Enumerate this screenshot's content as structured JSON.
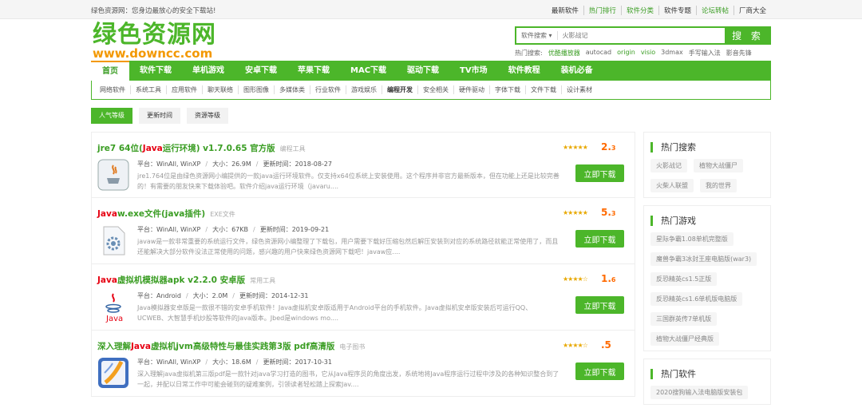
{
  "topbar": {
    "slogan": "绿色资源网：您身边最放心的安全下载站!",
    "links": [
      {
        "label": "最新软件",
        "green": false
      },
      {
        "label": "热门排行",
        "green": true
      },
      {
        "label": "软件分类",
        "green": true
      },
      {
        "label": "软件专题",
        "green": false
      },
      {
        "label": "论坛转帖",
        "green": true
      },
      {
        "label": "厂商大全",
        "green": false
      }
    ]
  },
  "logo": {
    "cn": "绿色资源网",
    "en": "www.downcc.com"
  },
  "search": {
    "scope": "软件搜索 ▾",
    "placeholder": "火影战记",
    "button": "搜 索",
    "hot_label": "热门搜索:",
    "hot": [
      {
        "label": "优酷播放器",
        "green": true
      },
      {
        "label": "autocad",
        "green": false
      },
      {
        "label": "origin",
        "green": true
      },
      {
        "label": "visio",
        "green": true
      },
      {
        "label": "3dmax",
        "green": false
      },
      {
        "label": "手写输入法",
        "green": false
      },
      {
        "label": "影音先锋",
        "green": false
      }
    ]
  },
  "nav": [
    "首页",
    "软件下载",
    "单机游戏",
    "安卓下载",
    "苹果下载",
    "MAC下载",
    "驱动下载",
    "TV市场",
    "软件教程",
    "装机必备"
  ],
  "subnav": [
    "网络软件",
    "系统工具",
    "应用软件",
    "聊天联络",
    "图形图像",
    "多媒体类",
    "行业软件",
    "游戏娱乐",
    "编程开发",
    "安全相关",
    "硬件驱动",
    "字体下载",
    "文件下载",
    "设计素材"
  ],
  "tabs": [
    "人气等级",
    "更新时间",
    "资源等级"
  ],
  "items": [
    {
      "pre": "jre7 64位(",
      "red": "Java",
      "post": "运行环境) v1.7.0.65 官方版",
      "cat": "编程工具",
      "platform": "平台：WinAll, WinXP",
      "size": "大小：26.9M",
      "date": "更新时间：2018-08-27",
      "desc": "jre1.764位是由绿色资源网小编提供的一款java运行环境软件。仅支持x64位系统上安装使用。这个程序并非官方最新版本，但在功能上还是比较完善的！有需要的朋友快来下载体验吧。软件介绍java运行环境（javaru....",
      "stars": 5,
      "score_main": "2.",
      "score_small": "3",
      "button": "立即下载",
      "icon": "java-cup-icon"
    },
    {
      "pre": "",
      "red": "Java",
      "post": "w.exe文件(java插件)",
      "cat": "EXE文件",
      "platform": "平台：WinAll, WinXP",
      "size": "大小：67KB",
      "date": "更新时间：2019-09-21",
      "desc": "javaw是一款非常重要的系统运行文件，绿色资源网小编整理了下载包，用户需要下载好压缩包然后解压安装到对应的系统路径就能正常使用了，而且还能解决大部分软件没法正常使用的问题，感兴趣的用户快来绿色资源网下载吧！javaw应....",
      "stars": 5,
      "score_main": "5.",
      "score_small": "3",
      "button": "立即下载",
      "icon": "exe-file-gear-icon"
    },
    {
      "pre": "",
      "red": "Java",
      "post": "虚拟机模拟器apk v2.2.0 安卓版",
      "cat": "常用工具",
      "platform": "平台：Android",
      "size": "大小：2.0M",
      "date": "更新时间：2014-12-31",
      "desc": "Java模拟器安卓版是一款很不错的安卓手机软件！Java虚拟机安卓版适用于Android平台的手机软件。Java虚拟机安卓版安装后可运行QQ、UCWEB、大智慧手机炒股等软件的Java版本。Jbed是windows mo....",
      "stars": 4,
      "score_main": "1.",
      "score_small": "6",
      "button": "立即下载",
      "icon": "java-logo-icon"
    },
    {
      "pre": "深入理解",
      "red": "Java",
      "post": "虚拟机jvm高级特性与最佳实践第3版 pdf高清版",
      "cat": "电子图书",
      "platform": "平台：WinAll, WinXP",
      "size": "大小：18.6M",
      "date": "更新时间：2017-10-31",
      "desc": "深入理解java虚拟机第三版pdf是一款针对java学习打造的图书，它从Java程序员的角度出发，系统地将Java程序运行过程中涉及的各种知识整合到了一起，并配以日常工作中可能会碰到的疑难案例，引领读者轻松踏上探索Jav....",
      "stars": 4,
      "score_main": ".5",
      "score_small": "",
      "button": "立即下载",
      "icon": "ebook-icon"
    }
  ],
  "sidebar": [
    {
      "title": "热门搜索",
      "tags": [
        "火影战记",
        "植物大战僵尸",
        "火柴人联盟",
        "我的世界"
      ]
    },
    {
      "title": "热门游戏",
      "tags": [
        "星际争霸1.08单机完整版",
        "魔兽争霸3冰封王座电脑版(war3)",
        "反恐精英cs1.5正版",
        "反恐精英cs1.6单机版电脑版",
        "三国群英传7单机版",
        "植物大战僵尸经典版"
      ]
    },
    {
      "title": "热门软件",
      "tags": [
        "2020搜狗输入法电脑版安装包"
      ]
    }
  ],
  "colors": {
    "brand_green": "#4cb62a",
    "accent_orange": "#f39800",
    "title_red": "#e60012",
    "score_orange": "#ff6a00"
  }
}
